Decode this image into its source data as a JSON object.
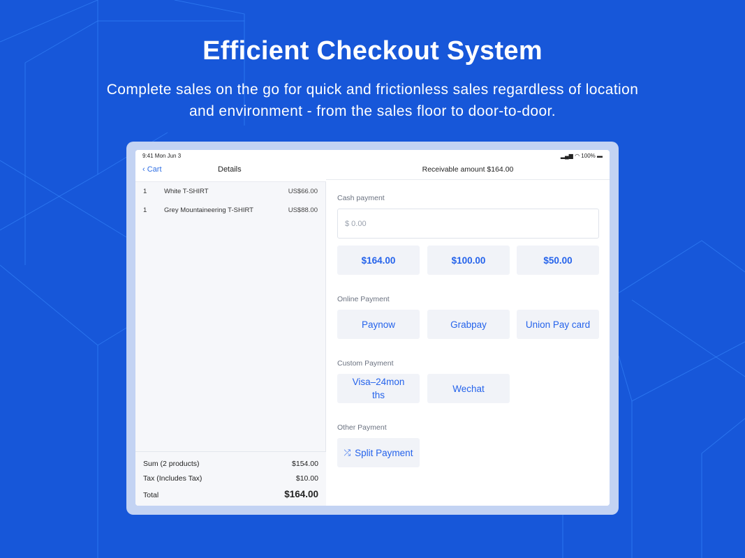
{
  "hero": {
    "title": "Efficient Checkout System",
    "subtitle_line1": "Complete sales on the go for quick and frictionless sales regardless of location",
    "subtitle_line2": "and environment - from the sales floor to door-to-door."
  },
  "status_bar": {
    "time": "9:41  Mon Jun 3",
    "battery": "100%"
  },
  "left": {
    "back_label": "Cart",
    "title": "Details",
    "items": [
      {
        "qty": "1",
        "name": "White T-SHIRT",
        "price": "US$66.00"
      },
      {
        "qty": "1",
        "name": "Grey Mountaineering T-SHIRT",
        "price": "US$88.00"
      }
    ],
    "summary": {
      "sum_label": "Sum (2 products)",
      "sum_value": "$154.00",
      "tax_label": "Tax (Includes Tax)",
      "tax_value": "$10.00",
      "total_label": "Total",
      "total_value": "$164.00"
    }
  },
  "right": {
    "receivable": "Receivable amount $164.00",
    "cash": {
      "label": "Cash payment",
      "placeholder": "$ 0.00",
      "quick_amounts": [
        "$164.00",
        "$100.00",
        "$50.00"
      ]
    },
    "online": {
      "label": "Online Payment",
      "options": [
        "Paynow",
        "Grabpay",
        "Union Pay card"
      ]
    },
    "custom": {
      "label": "Custom Payment",
      "options": [
        "Visa–24mon ths",
        "Wechat"
      ]
    },
    "other": {
      "label": "Other Payment",
      "split_label": "Split Payment"
    }
  },
  "colors": {
    "background": "#1757d9",
    "accent": "#2563eb",
    "frame": "#c3d3f3"
  },
  "icons": {
    "back": "chevron-left-icon",
    "split": "shuffle-icon",
    "signal": "signal-icon",
    "wifi": "wifi-icon",
    "battery": "battery-icon"
  }
}
